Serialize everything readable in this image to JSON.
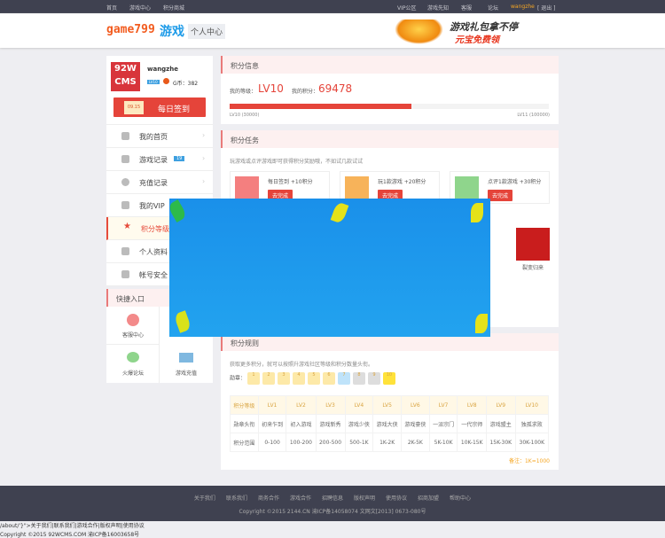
{
  "topbar": {
    "left": [
      "首页",
      "游戏中心",
      "积分商城"
    ],
    "right": [
      "VIP公区",
      "游戏先知",
      "客服",
      "论坛"
    ],
    "user": "wangzhe",
    "logout": "[ 退出 ]"
  },
  "header": {
    "logo_text": "game799",
    "logo_game": "游戏",
    "center": "个人中心",
    "ad_line1": "游戏礼包拿不停",
    "ad_line2": "元宝免费领"
  },
  "profile": {
    "avatar_text": "92W CMS",
    "username": "wangzhe",
    "badge": "LV10",
    "gb_label": "G币：382",
    "sign_date": "09.15",
    "sign_label": "每日签到"
  },
  "menu": [
    {
      "label": "我的首页"
    },
    {
      "label": "游戏记录",
      "badge": "19"
    },
    {
      "label": "充值记录"
    },
    {
      "label": "我的VIP"
    },
    {
      "label": "积分等级",
      "active": true
    },
    {
      "label": "个人资料"
    },
    {
      "label": "帐号安全"
    }
  ],
  "quick": {
    "title": "快捷入口",
    "items": [
      "客服中心",
      "火爆论坛",
      "游戏充值"
    ]
  },
  "points_info": {
    "title": "积分信息",
    "level_label": "我的等级：",
    "level": "LV10",
    "points_label": "我的积分：",
    "points": "69478",
    "progress_percent": 57,
    "min_label": "LV10 (30000)",
    "max_label": "LV11 (100000)"
  },
  "tasks": {
    "title": "积分任务",
    "desc": "玩游戏或点评游戏即可获得积分奖励哦，不如试几款试试",
    "items": [
      {
        "title": "每日签到 +10积分",
        "btn": "去完成",
        "color": "#f47f7f"
      },
      {
        "title": "玩1款游戏 +20积分",
        "btn": "去完成",
        "color": "#f7b35a"
      },
      {
        "title": "点评1款游戏 +30积分",
        "btn": "去完成",
        "color": "#8fd58c"
      }
    ],
    "game": "裂变归来"
  },
  "rules": {
    "title": "积分规则",
    "desc": "获取更多积分，就可以按照升游戏社区等级和积分数量头衔。",
    "medal_label": "勋章：",
    "medals": [
      "1",
      "2",
      "3",
      "4",
      "5",
      "6",
      "7",
      "8",
      "9",
      "10"
    ],
    "header": [
      "积分等级",
      "LV1",
      "LV2",
      "LV3",
      "LV4",
      "LV5",
      "LV6",
      "LV7",
      "LV8",
      "LV9",
      "LV10"
    ],
    "rows": [
      [
        "勋章头衔",
        "初来乍到",
        "初入游戏",
        "游戏新秀",
        "游戏少侠",
        "游戏大侠",
        "游戏豪侠",
        "一派宗门",
        "一代宗师",
        "游戏盟主",
        "独孤求败"
      ],
      [
        "积分范围",
        "0-100",
        "100-200",
        "200-500",
        "500-1K",
        "1K-2K",
        "2K-5K",
        "5K-10K",
        "10K-15K",
        "15K-30K",
        "30K-100K"
      ]
    ],
    "note": "备注：1K=1000"
  },
  "footer": {
    "links": [
      "关于我们",
      "联系我们",
      "商务合作",
      "游戏合作",
      "招聘信息",
      "版权声明",
      "使用协议",
      "招商加盟",
      "帮助中心"
    ],
    "copyright": "Copyright  ©2015 2144.CN  渝ICP备14058074  文网文[2013] 0673-080号"
  },
  "bottom": {
    "line1": "/about/'}\">关于我们|联系我们|游戏合作|版权声明|使用协议",
    "line2": "Copyright  ©2015 92WCMS.COM  渝ICP备16003658号"
  }
}
